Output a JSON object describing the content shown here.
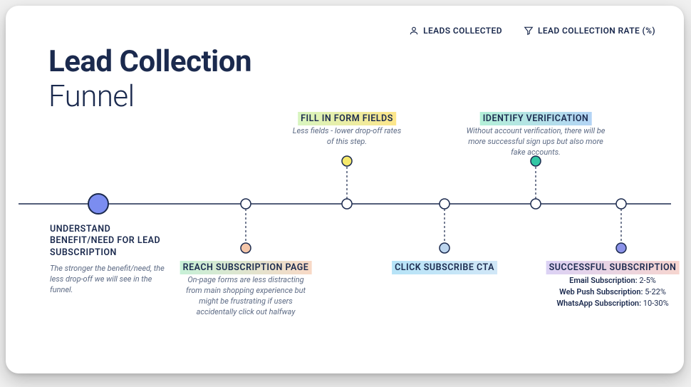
{
  "title": {
    "line1": "Lead Collection",
    "line2": "Funnel"
  },
  "legend": {
    "leads": "LEADS COLLECTED",
    "rate": "LEAD COLLECTION RATE (%)"
  },
  "steps": {
    "s1": {
      "label": "UNDERSTAND BENEFIT/NEED FOR LEAD SUBSCRIPTION",
      "desc": "The stronger the benefit/need, the less drop-off we will see in the funnel."
    },
    "s2": {
      "label": "REACH SUBSCRIPTION PAGE",
      "desc": "On-page forms are less distracting from main shopping experience but might be frustrating if users accidentally click out halfway"
    },
    "s3": {
      "label": "FILL IN FORM FIELDS",
      "desc": "Less fields - lower drop-off rates of this step."
    },
    "s4": {
      "label": "CLICK SUBSCRIBE CTA"
    },
    "s5": {
      "label": "IDENTIFY VERIFICATION",
      "desc": "Without account verification, there will be more successful sign ups but also more fake accounts."
    },
    "s6": {
      "label": "SUCCESSFUL SUBSCRIPTION",
      "benchmarks": {
        "email_label": "Email Subscription:",
        "email_value": " 2-5%",
        "webpush_label": "Web Push Subscription:",
        "webpush_value": " 5-22%",
        "whatsapp_label": "WhatsApp Subscription:",
        "whatsapp_value": " 10-30%"
      }
    }
  },
  "colors": {
    "s2_chip_a": "#c7f0d7",
    "s2_chip_b": "#f8d9c6",
    "s3_chip_a": "#d8f5c0",
    "s3_chip_b": "#fde68a",
    "s4_chip_a": "#b6e3f7",
    "s4_chip_b": "#d1e7f7",
    "s5_chip_a": "#b4f0d8",
    "s5_chip_b": "#b3d4f5",
    "s6_chip_a": "#dcd2f5",
    "s6_chip_b": "#f6d5cf"
  }
}
